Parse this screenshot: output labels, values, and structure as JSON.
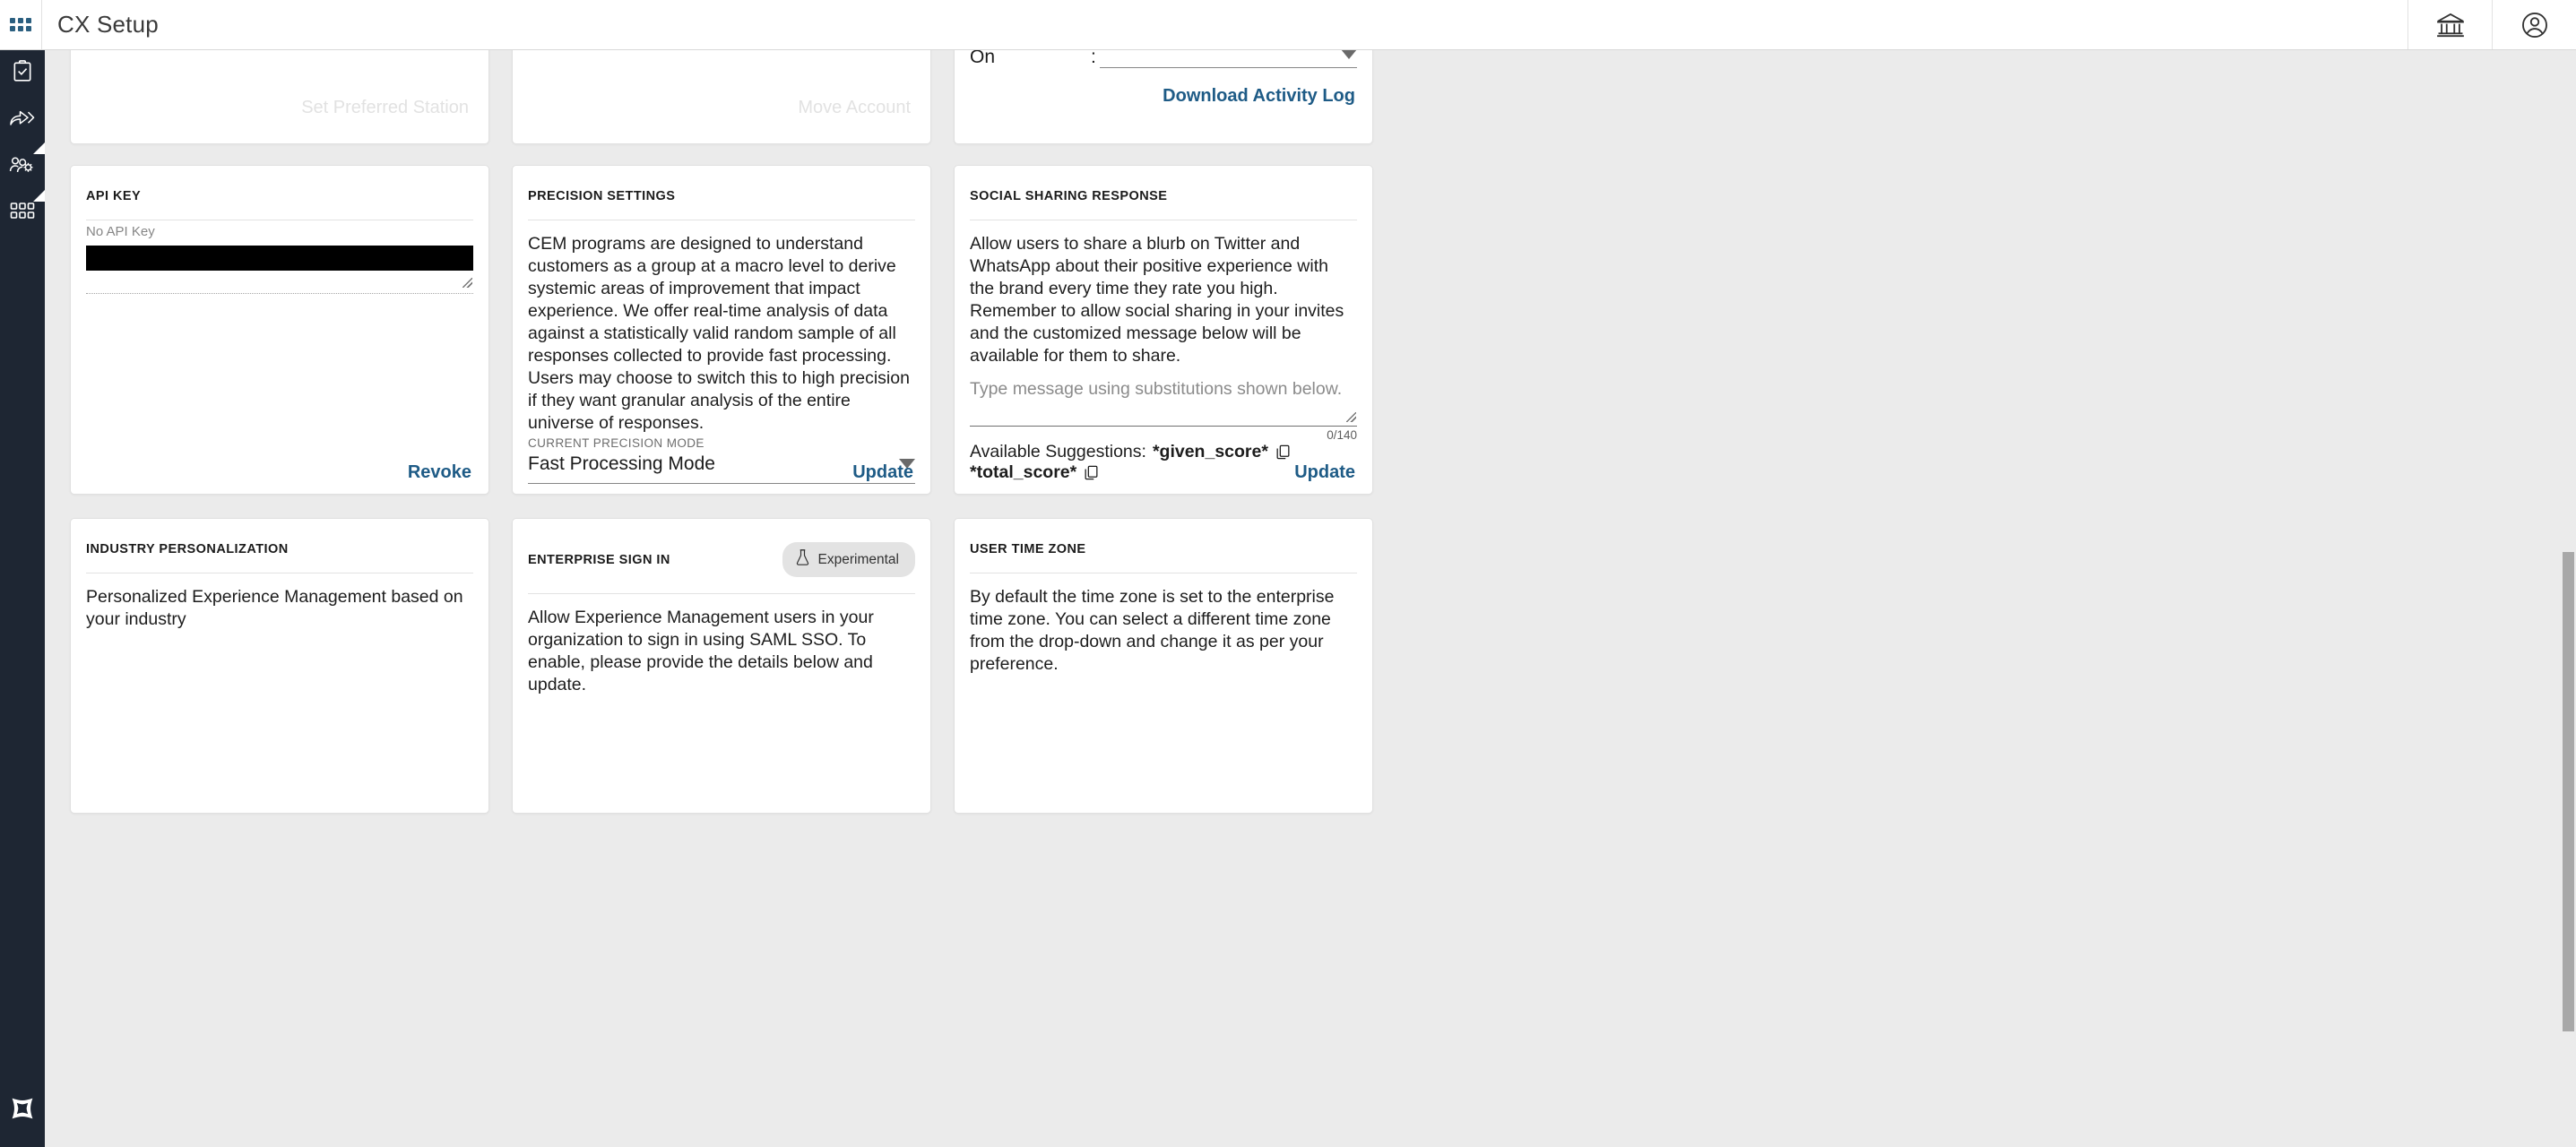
{
  "topbar": {
    "title": "CX Setup",
    "apps_icon": "apps-grid-icon",
    "bank_icon": "bank-icon",
    "account_icon": "account-circle-icon"
  },
  "sidebar": {
    "items": [
      {
        "name": "clipboard-check-icon",
        "label": "Surveys"
      },
      {
        "name": "share-forward-icon",
        "label": "Distribute"
      },
      {
        "name": "users-gear-icon",
        "label": "User Management"
      },
      {
        "name": "grid-apps-icon",
        "label": "Apps"
      }
    ],
    "logo": "brand-logo-icon"
  },
  "cards": {
    "set_preferred_station": {
      "ghost_label": "Set Preferred Station"
    },
    "move_account": {
      "ghost_label": "Move Account"
    },
    "activity_log": {
      "on_label": "On",
      "colon": ":",
      "select_value": "",
      "action": "Download Activity Log"
    },
    "api_key": {
      "title": "API Key",
      "note": "No API Key",
      "value": "",
      "action": "Revoke"
    },
    "precision_settings": {
      "title": "Precision Settings",
      "description": "CEM programs are designed to understand customers as a group at a macro level to derive systemic areas of improvement that impact experience. We offer real-time analysis of data against a statistically valid random sample of all responses collected to provide fast processing. Users may choose to switch this to high precision if they want granular analysis of the entire universe of responses.",
      "field_label": "Current Precision Mode",
      "selected_mode": "Fast Processing Mode",
      "action": "Update"
    },
    "social_sharing_response": {
      "title": "Social Sharing Response",
      "description_1": "Allow users to share a blurb on Twitter and WhatsApp about their positive experience with the brand every time they rate you high.",
      "description_2": "Remember to allow social sharing in your invites and the customized message below will be available for them to share.",
      "message_placeholder": "Type message using substitutions shown below.",
      "message_value": "",
      "counter": "0/140",
      "suggestions_label": "Available Suggestions:",
      "suggestion_1": "*given_score*",
      "suggestion_2": "*total_score*",
      "copy_icon": "copy-icon",
      "action": "Update"
    },
    "industry_personalization": {
      "title": "Industry Personalization",
      "description": "Personalized Experience Management based on your industry"
    },
    "enterprise_sign_in": {
      "title": "Enterprise Sign In",
      "badge_label": "Experimental",
      "badge_icon": "flask-icon",
      "description": "Allow Experience Management users in your organization to sign in using SAML SSO. To enable, please provide the details below and update."
    },
    "user_time_zone": {
      "title": "User Time Zone",
      "description": "By default the time zone is set to the enterprise time zone. You can select a different time zone from the drop-down and change it as per your preference."
    }
  },
  "colors": {
    "sidebar_bg": "#1e2633",
    "accent_link": "#1e5b86",
    "page_bg": "#ebebeb",
    "card_bg": "#ffffff"
  }
}
